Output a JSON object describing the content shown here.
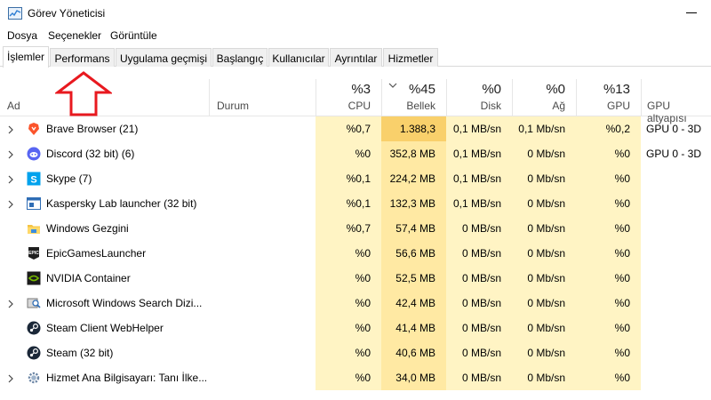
{
  "window": {
    "title": "Görev Yöneticisi"
  },
  "menu": [
    "Dosya",
    "Seçenekler",
    "Görüntüle"
  ],
  "tabs": [
    {
      "label": "İşlemler",
      "active": true
    },
    {
      "label": "Performans",
      "active": false
    },
    {
      "label": "Uygulama geçmişi",
      "active": false
    },
    {
      "label": "Başlangıç",
      "active": false
    },
    {
      "label": "Kullanıcılar",
      "active": false
    },
    {
      "label": "Ayrıntılar",
      "active": false
    },
    {
      "label": "Hizmetler",
      "active": false
    }
  ],
  "columns": {
    "name": "Ad",
    "status": "Durum",
    "cpu": {
      "pct": "%3",
      "label": "CPU"
    },
    "memory": {
      "pct": "%45",
      "label": "Bellek"
    },
    "disk": {
      "pct": "%0",
      "label": "Disk"
    },
    "network": {
      "pct": "%0",
      "label": "Ağ"
    },
    "gpu": {
      "pct": "%13",
      "label": "GPU"
    },
    "gpu_engine": "GPU altyapısı"
  },
  "colors": {
    "heat_light": "#fff4c4",
    "heat_mid": "#ffe9a3",
    "heat_strong": "#f9d06b",
    "annotation_red": "#e8191f"
  },
  "processes": [
    {
      "name": "Brave Browser (21)",
      "icon": "brave-icon",
      "expandable": true,
      "cpu": "%0,7",
      "mem": "1.388,3 MB",
      "disk": "0,1 MB/sn",
      "net": "0,1 Mb/sn",
      "gpu": "%0,2",
      "engine": "GPU 0 - 3D"
    },
    {
      "name": "Discord (32 bit) (6)",
      "icon": "discord-icon",
      "expandable": true,
      "cpu": "%0",
      "mem": "352,8 MB",
      "disk": "0,1 MB/sn",
      "net": "0 Mb/sn",
      "gpu": "%0",
      "engine": "GPU 0 - 3D"
    },
    {
      "name": "Skype (7)",
      "icon": "skype-icon",
      "expandable": true,
      "cpu": "%0,1",
      "mem": "224,2 MB",
      "disk": "0,1 MB/sn",
      "net": "0 Mb/sn",
      "gpu": "%0",
      "engine": ""
    },
    {
      "name": "Kaspersky Lab launcher (32 bit)",
      "icon": "kaspersky-icon",
      "expandable": true,
      "cpu": "%0,1",
      "mem": "132,3 MB",
      "disk": "0,1 MB/sn",
      "net": "0 Mb/sn",
      "gpu": "%0",
      "engine": ""
    },
    {
      "name": "Windows Gezgini",
      "icon": "folder-icon",
      "expandable": false,
      "cpu": "%0,7",
      "mem": "57,4 MB",
      "disk": "0 MB/sn",
      "net": "0 Mb/sn",
      "gpu": "%0",
      "engine": ""
    },
    {
      "name": "EpicGamesLauncher",
      "icon": "epic-games-icon",
      "expandable": false,
      "cpu": "%0",
      "mem": "56,6 MB",
      "disk": "0 MB/sn",
      "net": "0 Mb/sn",
      "gpu": "%0",
      "engine": ""
    },
    {
      "name": "NVIDIA Container",
      "icon": "nvidia-icon",
      "expandable": false,
      "cpu": "%0",
      "mem": "52,5 MB",
      "disk": "0 MB/sn",
      "net": "0 Mb/sn",
      "gpu": "%0",
      "engine": ""
    },
    {
      "name": "Microsoft Windows Search Dizi...",
      "icon": "search-indexer-icon",
      "expandable": true,
      "cpu": "%0",
      "mem": "42,4 MB",
      "disk": "0 MB/sn",
      "net": "0 Mb/sn",
      "gpu": "%0",
      "engine": ""
    },
    {
      "name": "Steam Client WebHelper",
      "icon": "steam-icon",
      "expandable": false,
      "cpu": "%0",
      "mem": "41,4 MB",
      "disk": "0 MB/sn",
      "net": "0 Mb/sn",
      "gpu": "%0",
      "engine": ""
    },
    {
      "name": "Steam (32 bit)",
      "icon": "steam-icon",
      "expandable": false,
      "cpu": "%0",
      "mem": "40,6 MB",
      "disk": "0 MB/sn",
      "net": "0 Mb/sn",
      "gpu": "%0",
      "engine": ""
    },
    {
      "name": "Hizmet Ana Bilgisayarı: Tanı İlke...",
      "icon": "gear-icon",
      "expandable": true,
      "cpu": "%0",
      "mem": "34,0 MB",
      "disk": "0 MB/sn",
      "net": "0 Mb/sn",
      "gpu": "%0",
      "engine": ""
    }
  ]
}
